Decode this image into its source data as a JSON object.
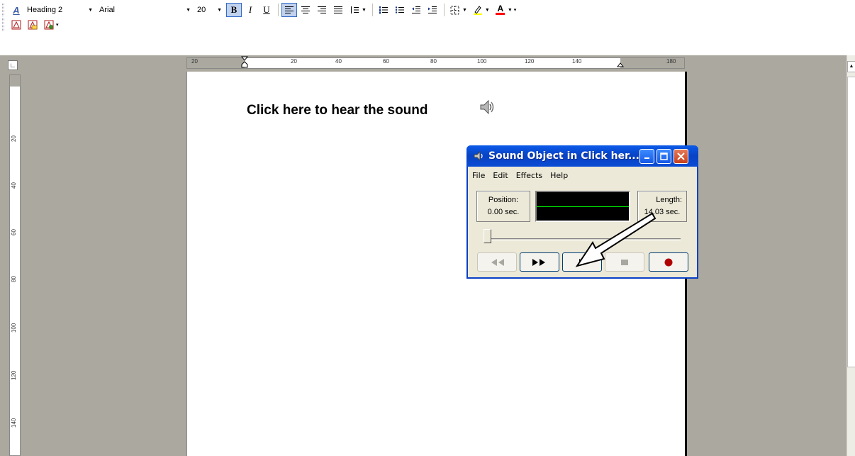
{
  "formatting_toolbar": {
    "style_value": "Heading 2",
    "font_value": "Arial",
    "size_value": "20",
    "bold_label": "B",
    "italic_label": "I",
    "underline_label": "U",
    "font_color_label": "A"
  },
  "ruler": {
    "ticks": [
      "20",
      "20",
      "40",
      "60",
      "80",
      "100",
      "120",
      "140",
      "180"
    ],
    "vticks": [
      "20",
      "40",
      "60",
      "80",
      "100",
      "120",
      "140"
    ]
  },
  "document": {
    "heading": "Click here to hear the sound"
  },
  "sound_dialog": {
    "title": "Sound Object in Click her...",
    "menu": [
      "File",
      "Edit",
      "Effects",
      "Help"
    ],
    "position_label": "Position:",
    "position_value": "0.00 sec.",
    "length_label": "Length:",
    "length_value": "14.03 sec.",
    "wave_color": "#00ff00",
    "record_color": "#b00000"
  },
  "colors": {
    "titlebar": "#0a4cd5",
    "workspace": "#aba99f",
    "pressed": "#c1d2ee"
  }
}
